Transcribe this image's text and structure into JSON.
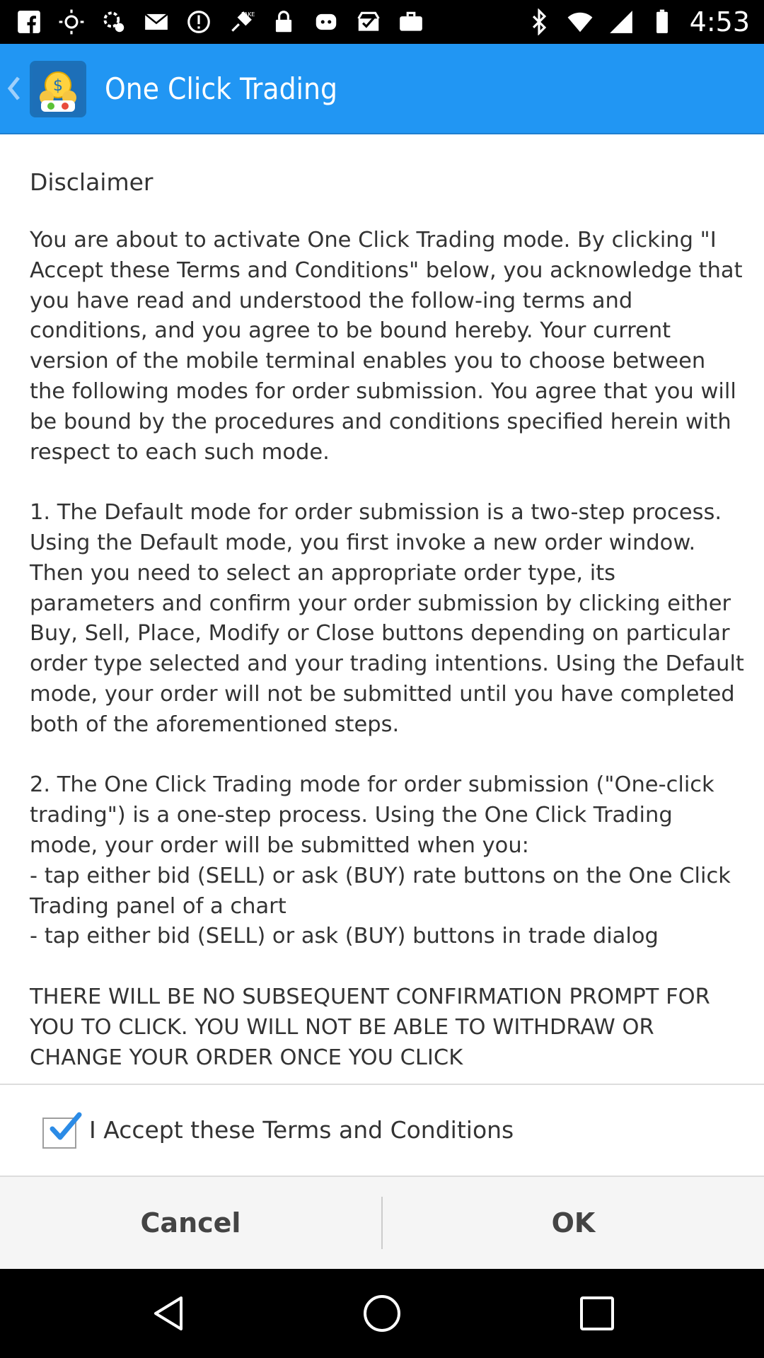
{
  "status_bar": {
    "left_icons": [
      "facebook-icon",
      "weather-icon",
      "settings-sync-icon",
      "mail-icon",
      "alert-icon",
      "fake-gps-icon",
      "lock-icon",
      "game-controller-icon",
      "task-icon",
      "briefcase-icon"
    ],
    "right_icons": [
      "bluetooth-icon",
      "wifi-icon",
      "signal-icon",
      "battery-icon"
    ],
    "time": "4:53"
  },
  "action_bar": {
    "title": "One Click Trading",
    "color": "#2196f3"
  },
  "content": {
    "heading": "Disclaimer",
    "body": "You are about to activate One Click Trading mode. By clicking \"I Accept these Terms and Conditions\" below, you acknowledge that you have read and understood the follow-ing terms and conditions, and you agree to be bound hereby. Your current version of the mobile terminal enables you to choose between the following modes for order submission. You agree that you will be bound by the procedures and conditions specified herein with respect to each such mode.\n\n1. The Default mode for order submission is a two-step process. Using the Default mode, you first invoke a new order window. Then you need to select an appropriate order type, its parameters and confirm your order submission by clicking either Buy, Sell, Place, Modify or Close buttons depending on particular order type selected and your trading intentions. Using the Default mode, your order will not be submitted until you have completed both of the aforementioned steps.\n\n2. The One Click Trading mode for order submission (\"One-click trading\") is a one-step process. Using the One Click Trading mode, your order will be submitted when you:\n- tap either bid (SELL) or ask (BUY) rate buttons on the One Click Trading panel of a chart\n- tap either bid (SELL) or ask (BUY) buttons in trade dialog\n\nTHERE WILL BE NO SUBSEQUENT CONFIRMATION PROMPT FOR YOU TO CLICK. YOU WILL NOT BE ABLE TO WITHDRAW OR CHANGE YOUR ORDER ONCE YOU CLICK"
  },
  "accept": {
    "label": "I Accept these Terms and Conditions",
    "checked": true
  },
  "buttons": {
    "cancel": "Cancel",
    "ok": "OK"
  }
}
